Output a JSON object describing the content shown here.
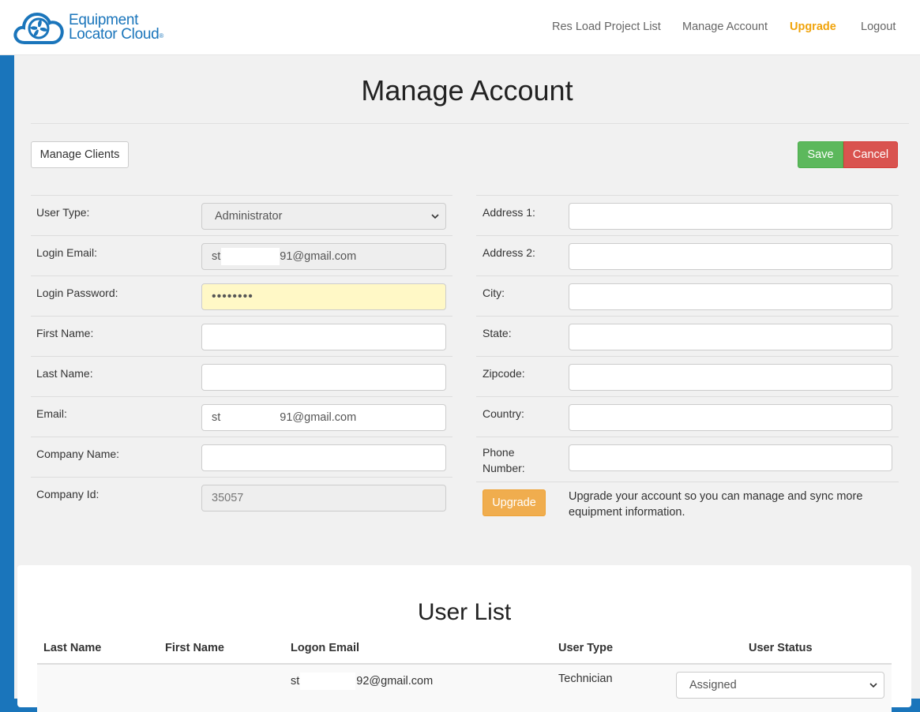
{
  "app": {
    "logo_line1": "Equipment",
    "logo_line2": "Locator Cloud",
    "logo_reg": "®"
  },
  "nav": {
    "items": [
      {
        "label": "Res Load Project List"
      },
      {
        "label": "Manage Account"
      },
      {
        "label": "Upgrade"
      },
      {
        "label": "Logout"
      }
    ]
  },
  "page": {
    "title": "Manage Account",
    "manage_clients_label": "Manage Clients",
    "save_label": "Save",
    "cancel_label": "Cancel"
  },
  "left_form": {
    "user_type": {
      "label": "User Type:",
      "value": "Administrator"
    },
    "login_email": {
      "label": "Login Email:",
      "value_start": "st",
      "value_end": "91@gmail.com"
    },
    "login_password": {
      "label": "Login Password:",
      "value": "••••••••"
    },
    "first_name": {
      "label": "First Name:",
      "value": ""
    },
    "last_name": {
      "label": "Last Name:",
      "value": ""
    },
    "email": {
      "label": "Email:",
      "value_start": "st",
      "value_end": "91@gmail.com"
    },
    "company_name": {
      "label": "Company Name:",
      "value": ""
    },
    "company_id": {
      "label": "Company Id:",
      "value": "35057"
    }
  },
  "right_form": {
    "address1": {
      "label": "Address 1:",
      "value": ""
    },
    "address2": {
      "label": "Address 2:",
      "value": ""
    },
    "city": {
      "label": "City:",
      "value": ""
    },
    "state": {
      "label": "State:",
      "value": ""
    },
    "zipcode": {
      "label": "Zipcode:",
      "value": ""
    },
    "country": {
      "label": "Country:",
      "value": ""
    },
    "phone": {
      "label_line1": "Phone",
      "label_line2": "Number:",
      "value": ""
    },
    "upgrade_button": "Upgrade",
    "upgrade_note_line1": "Upgrade your account so you can manage and sync more",
    "upgrade_note_line2": "equipment information."
  },
  "user_list": {
    "title": "User List",
    "columns": [
      "Last Name",
      "First Name",
      "Logon Email",
      "User Type",
      "User Status"
    ],
    "rows": [
      {
        "last_name": "",
        "first_name": "",
        "email_start": "st",
        "email_end": "92@gmail.com",
        "user_type": "Technician",
        "user_status": "Assigned"
      }
    ]
  },
  "colors": {
    "brand_blue": "#1a75bb",
    "upgrade_orange": "#f0a30a",
    "save_green": "#5cb85c",
    "cancel_red": "#d9534f"
  }
}
